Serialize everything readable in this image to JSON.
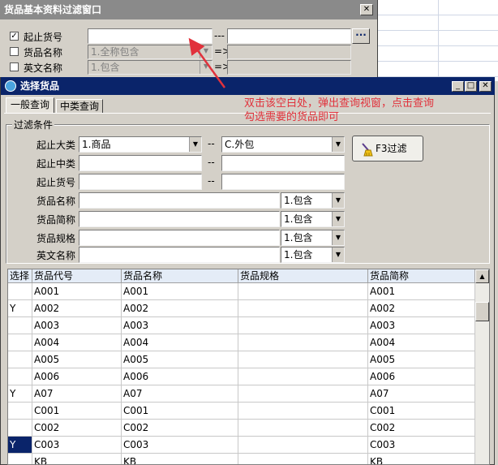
{
  "outer": {
    "title": "货品基本资料过滤窗口",
    "close_glyph": "✕",
    "rows": [
      {
        "label": "起止货号",
        "checked": true,
        "from_value": "",
        "sep": "---",
        "to_value": "",
        "browse": "···"
      },
      {
        "label": "货品名称",
        "checked": false,
        "from_value": "1.全称包含",
        "sep": "=>"
      },
      {
        "label": "英文名称",
        "checked": false,
        "from_value": "1.包含",
        "sep": "=>"
      }
    ]
  },
  "inner": {
    "title": "选择货品",
    "buttons": {
      "minimize": "_",
      "maximize": "□",
      "close": "✕"
    },
    "tabs": [
      "一般查询",
      "中类查询"
    ],
    "group_title": "过滤条件",
    "filters": {
      "category": {
        "label": "起止大类",
        "from": "1.商品",
        "to": "C.外包"
      },
      "middle": {
        "label": "起止中类",
        "from": "",
        "to": ""
      },
      "item_no": {
        "label": "起止货号",
        "from": "",
        "to": ""
      },
      "dash": "--",
      "text_filters": [
        {
          "label": "货品名称",
          "value": "",
          "mode": "1.包含"
        },
        {
          "label": "货品简称",
          "value": "",
          "mode": "1.包含"
        },
        {
          "label": "货品规格",
          "value": "",
          "mode": "1.包含"
        },
        {
          "label": "英文名称",
          "value": "",
          "mode": "1.包含"
        }
      ]
    },
    "filter_button": "F3过滤",
    "table": {
      "columns": [
        "选择",
        "货品代号",
        "货品名称",
        "货品规格",
        "货品简称"
      ],
      "rows": [
        {
          "select": "",
          "code": "A001",
          "name": "A001",
          "spec": "",
          "short": "A001"
        },
        {
          "select": "Y",
          "code": "A002",
          "name": "A002",
          "spec": "",
          "short": "A002"
        },
        {
          "select": "",
          "code": "A003",
          "name": "A003",
          "spec": "",
          "short": "A003"
        },
        {
          "select": "",
          "code": "A004",
          "name": "A004",
          "spec": "",
          "short": "A004"
        },
        {
          "select": "",
          "code": "A005",
          "name": "A005",
          "spec": "",
          "short": "A005"
        },
        {
          "select": "",
          "code": "A006",
          "name": "A006",
          "spec": "",
          "short": "A006"
        },
        {
          "select": "Y",
          "code": "A07",
          "name": "A07",
          "spec": "",
          "short": "A07"
        },
        {
          "select": "",
          "code": "C001",
          "name": "C001",
          "spec": "",
          "short": "C001"
        },
        {
          "select": "",
          "code": "C002",
          "name": "C002",
          "spec": "",
          "short": "C002"
        },
        {
          "select": "Y",
          "code": "C003",
          "name": "C003",
          "spec": "",
          "short": "C003"
        },
        {
          "select": "",
          "code": "KB",
          "name": "KB",
          "spec": "",
          "short": "KB"
        }
      ]
    }
  },
  "annotation": {
    "line1": "双击该空白处，弹出查询视窗，点击查询",
    "line2": "勾选需要的货品即可",
    "color": "#e1323c"
  }
}
